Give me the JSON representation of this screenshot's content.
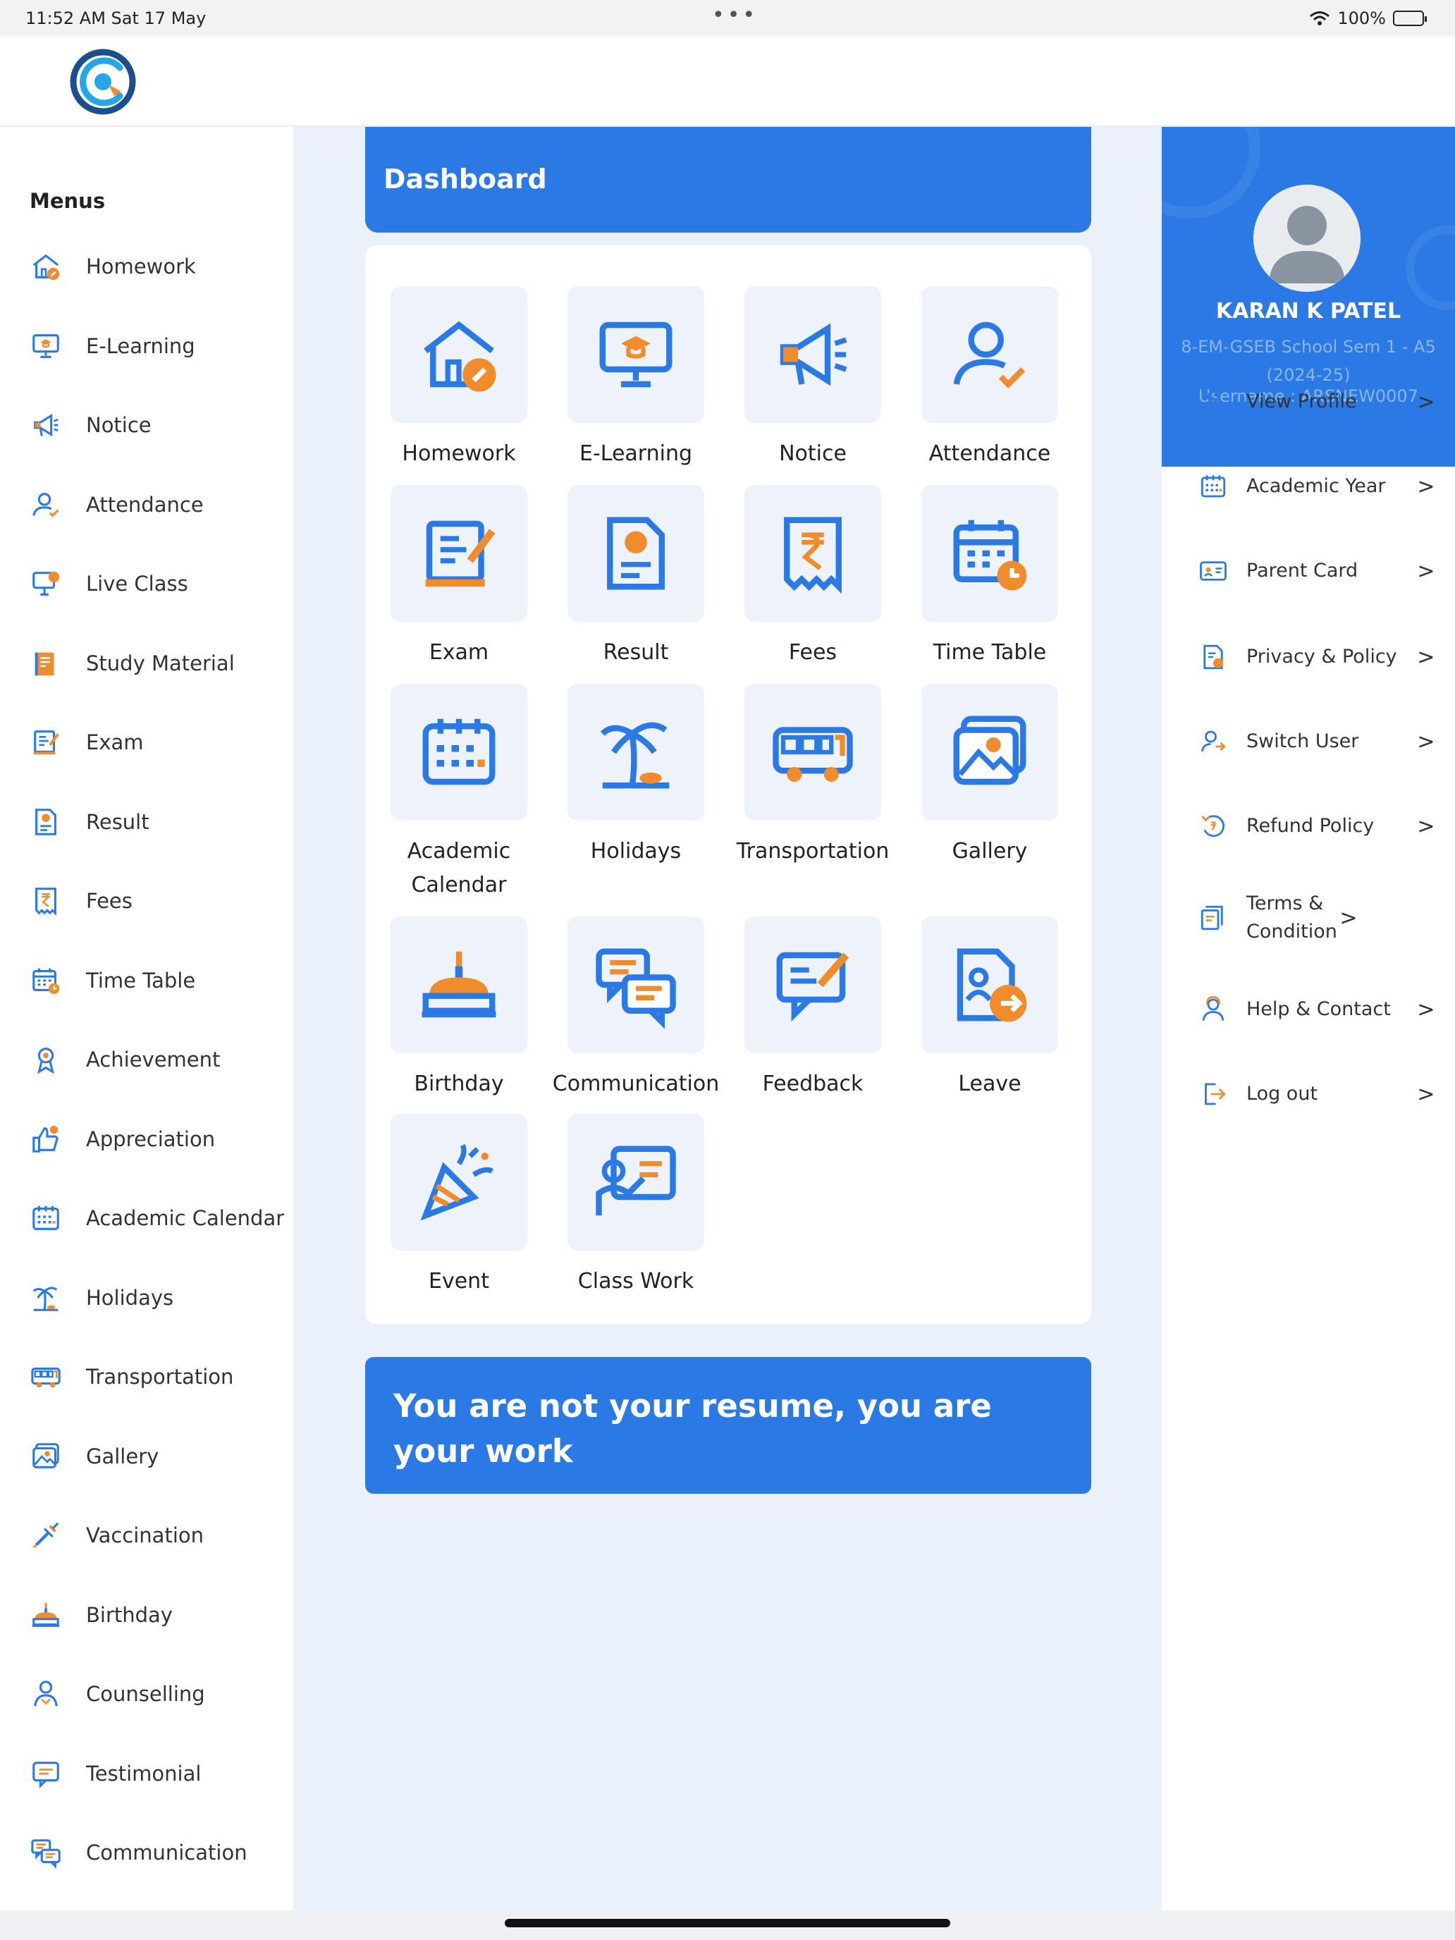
{
  "status": {
    "time": "11:52 AM  Sat 17 May",
    "battery": "100%"
  },
  "sidebar": {
    "title": "Menus",
    "items": [
      {
        "label": "Homework",
        "icon": "homework-icon"
      },
      {
        "label": "E-Learning",
        "icon": "elearning-icon"
      },
      {
        "label": "Notice",
        "icon": "notice-icon"
      },
      {
        "label": "Attendance",
        "icon": "attendance-icon"
      },
      {
        "label": "Live Class",
        "icon": "live-class-icon"
      },
      {
        "label": "Study Material",
        "icon": "study-material-icon"
      },
      {
        "label": "Exam",
        "icon": "exam-icon"
      },
      {
        "label": "Result",
        "icon": "result-icon"
      },
      {
        "label": "Fees",
        "icon": "fees-icon"
      },
      {
        "label": "Time Table",
        "icon": "timetable-icon"
      },
      {
        "label": "Achievement",
        "icon": "achievement-icon"
      },
      {
        "label": "Appreciation",
        "icon": "appreciation-icon"
      },
      {
        "label": "Academic Calendar",
        "icon": "calendar-icon"
      },
      {
        "label": "Holidays",
        "icon": "holidays-icon"
      },
      {
        "label": "Transportation",
        "icon": "bus-icon"
      },
      {
        "label": "Gallery",
        "icon": "gallery-icon"
      },
      {
        "label": "Vaccination",
        "icon": "vaccination-icon"
      },
      {
        "label": "Birthday",
        "icon": "birthday-icon"
      },
      {
        "label": "Counselling",
        "icon": "counselling-icon"
      },
      {
        "label": "Testimonial",
        "icon": "testimonial-icon"
      },
      {
        "label": "Communication",
        "icon": "communication-icon"
      }
    ]
  },
  "dashboard": {
    "title": "Dashboard",
    "tiles": [
      {
        "label": "Homework",
        "icon": "homework-icon"
      },
      {
        "label": "E-Learning",
        "icon": "elearning-icon"
      },
      {
        "label": "Notice",
        "icon": "notice-icon"
      },
      {
        "label": "Attendance",
        "icon": "attendance-icon"
      },
      {
        "label": "Exam",
        "icon": "exam-icon"
      },
      {
        "label": "Result",
        "icon": "result-icon"
      },
      {
        "label": "Fees",
        "icon": "fees-icon"
      },
      {
        "label": "Time Table",
        "icon": "timetable-icon"
      },
      {
        "label": "Academic Calendar",
        "icon": "calendar-icon"
      },
      {
        "label": "Holidays",
        "icon": "holidays-icon"
      },
      {
        "label": "Transportation",
        "icon": "bus-icon"
      },
      {
        "label": "Gallery",
        "icon": "gallery-icon"
      },
      {
        "label": "Birthday",
        "icon": "birthday-icon"
      },
      {
        "label": "Communication",
        "icon": "communication-icon"
      },
      {
        "label": "Feedback",
        "icon": "feedback-icon"
      },
      {
        "label": "Leave",
        "icon": "leave-icon"
      },
      {
        "label": "Event",
        "icon": "event-icon"
      },
      {
        "label": "Class Work",
        "icon": "classwork-icon"
      }
    ],
    "quote": "You are not your resume, you are your work"
  },
  "profile": {
    "name": "KARAN K PATEL",
    "class": "8-EM-GSEB School Sem 1 - A5 (2024-25)",
    "username": "Username : ARSNEW0007"
  },
  "right_menu": [
    {
      "label": "View Profile",
      "icon": "user-icon"
    },
    {
      "label": "Academic Year",
      "icon": "calendar-icon"
    },
    {
      "label": "Parent Card",
      "icon": "id-card-icon"
    },
    {
      "label": "Privacy & Policy",
      "icon": "privacy-icon"
    },
    {
      "label": "Switch User",
      "icon": "switch-user-icon"
    },
    {
      "label": "Refund Policy",
      "icon": "refund-icon"
    },
    {
      "label": "Terms & Condition",
      "icon": "terms-icon"
    },
    {
      "label": "Help & Contact",
      "icon": "help-icon"
    },
    {
      "label": "Log out",
      "icon": "logout-icon"
    }
  ],
  "chevron": ">",
  "colors": {
    "primary": "#2a79e4",
    "accent": "#f08c2b",
    "panel_bg": "#eaf1fb"
  }
}
